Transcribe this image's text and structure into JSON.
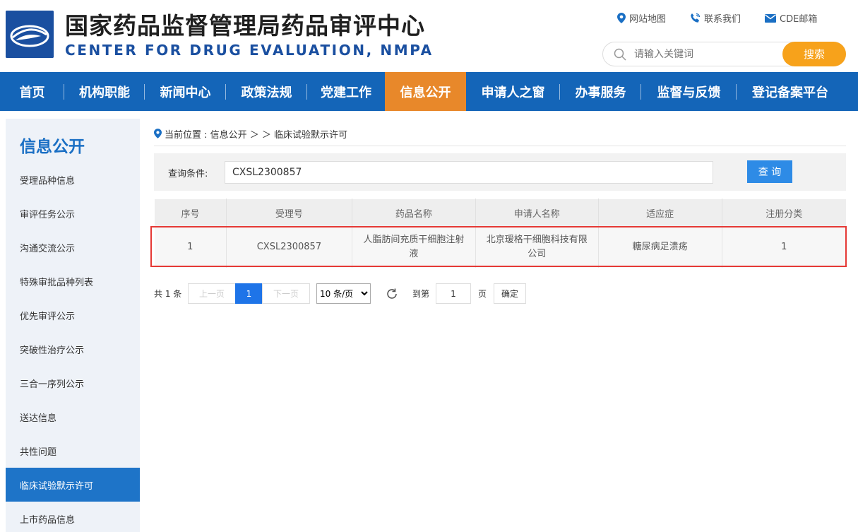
{
  "header": {
    "title_cn": "国家药品监督管理局药品审评中心",
    "title_en": "CENTER FOR DRUG EVALUATION, NMPA",
    "links": [
      "网站地图",
      "联系我们",
      "CDE邮箱"
    ],
    "search_placeholder": "请输入关键词",
    "search_button": "搜索"
  },
  "nav": {
    "items": [
      "首页",
      "机构职能",
      "新闻中心",
      "政策法规",
      "党建工作",
      "信息公开",
      "申请人之窗",
      "办事服务",
      "监督与反馈",
      "登记备案平台"
    ],
    "active": "信息公开"
  },
  "sidebar": {
    "title": "信息公开",
    "items": [
      "受理品种信息",
      "审评任务公示",
      "沟通交流公示",
      "特殊审批品种列表",
      "优先审评公示",
      "突破性治疗公示",
      "三合一序列公示",
      "送达信息",
      "共性问题",
      "临床试验默示许可",
      "上市药品信息"
    ],
    "active": "临床试验默示许可"
  },
  "breadcrumb": {
    "text": "当前位置 : 信息公开 ＞ ＞ 临床试验默示许可"
  },
  "query": {
    "label": "查询条件:",
    "value": "CXSL2300857",
    "button": "查 询"
  },
  "table": {
    "headers": [
      "序号",
      "受理号",
      "药品名称",
      "申请人名称",
      "适应症",
      "注册分类"
    ],
    "rows": [
      [
        "1",
        "CXSL2300857",
        "人脂肪间充质干细胞注射液",
        "北京瑷格干细胞科技有限公司",
        "糖尿病足溃疡",
        "1"
      ]
    ]
  },
  "pagination": {
    "total": "共 1 条",
    "prev": "上一页",
    "current": "1",
    "next": "下一页",
    "page_size": "10 条/页",
    "goto_label": "到第",
    "goto_value": "1",
    "page_unit": "页",
    "confirm": "确定"
  },
  "colors": {
    "brand_blue": "#1465b8",
    "nav_active": "#e8882a",
    "search_button": "#f7a21b",
    "highlight_border": "#e53935"
  }
}
